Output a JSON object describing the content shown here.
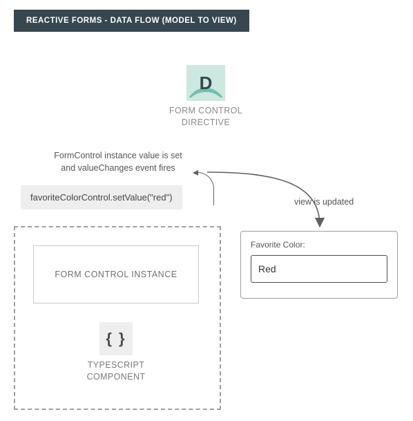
{
  "title": "REACTIVE FORMS - DATA FLOW (MODEL TO VIEW)",
  "directive": {
    "letter": "D",
    "label_line1": "FORM CONTROL",
    "label_line2": "DIRECTIVE"
  },
  "flow": {
    "description_line1": "FormControl instance value is set",
    "description_line2": "and valueChanges event fires",
    "code": "favoriteColorControl.setValue(\"red\")",
    "view_text": "view is updated"
  },
  "component": {
    "instance_label": "FORM CONTROL INSTANCE",
    "braces": "{ }",
    "ts_label_line1": "TYPESCRIPT",
    "ts_label_line2": "COMPONENT"
  },
  "view": {
    "field_label": "Favorite Color:",
    "field_value": "Red"
  }
}
